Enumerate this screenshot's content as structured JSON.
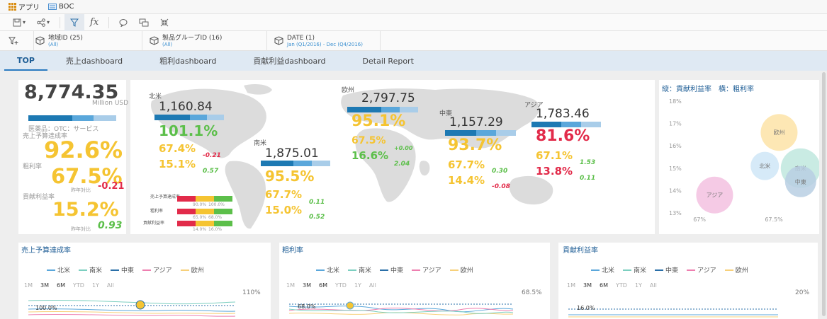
{
  "topbar": {
    "apps_label": "アプリ",
    "doc_label": "BOC"
  },
  "toolbar": {
    "fx_label": "fx"
  },
  "filters": [
    {
      "name": "地域ID (25)",
      "value": "(All)"
    },
    {
      "name": "製品グループID (16)",
      "value": "(All)"
    },
    {
      "name": "DATE (1)",
      "value": "Jan (Q1/2016) - Dec (Q4/2016)"
    }
  ],
  "tabs": [
    "TOP",
    "売上dashboard",
    "粗利dashboard",
    "貢献利益dashboard",
    "Detail Report"
  ],
  "summary": {
    "total": "8,774.35",
    "unit": "Million USD",
    "category": "医薬品：OTC：サービス",
    "sales_label": "売上予算達成率",
    "sales_value": "92.6%",
    "gross_label": "粗利率",
    "gross_value": "67.5%",
    "gross_yoy_label": "昨年対比",
    "gross_yoy": "-0.21",
    "contrib_label": "貢献利益率",
    "contrib_value": "15.2%",
    "contrib_yoy_label": "昨年対比",
    "contrib_yoy": "0.93"
  },
  "regions": {
    "na": {
      "name": "北米",
      "total": "1,160.84",
      "sales": "101.1%",
      "gross": "67.4%",
      "gross_d": "-0.21",
      "contrib": "15.1%",
      "contrib_d": "0.57"
    },
    "sa": {
      "name": "南米",
      "total": "1,875.01",
      "sales": "95.5%",
      "gross": "67.7%",
      "gross_d": "0.11",
      "contrib": "15.0%",
      "contrib_d": "0.52"
    },
    "eu": {
      "name": "欧州",
      "total": "2,797.75",
      "sales": "95.1%",
      "gross": "67.5%",
      "gross_d": "+0.00",
      "contrib": "16.6%",
      "contrib_d": "2.04"
    },
    "me": {
      "name": "中東",
      "total": "1,157.29",
      "sales": "93.7%",
      "gross": "67.7%",
      "gross_d": "0.30",
      "contrib": "14.4%",
      "contrib_d": "-0.08"
    },
    "as": {
      "name": "アジア",
      "total": "1,783.46",
      "sales": "81.6%",
      "gross": "67.1%",
      "gross_d": "1.53",
      "contrib": "13.8%",
      "contrib_d": "0.11"
    }
  },
  "map_legend": {
    "rows": [
      "売上予算達成率",
      "粗利率",
      "貢献利益率"
    ],
    "ticks": [
      "90.0%",
      "100.0%",
      "65.0%",
      "68.0%",
      "14.0%",
      "16.0%"
    ]
  },
  "scatter": {
    "title": "縦：貢献利益率　横：粗利率",
    "y_ticks": [
      "18%",
      "17%",
      "16%",
      "15%",
      "14%",
      "13%"
    ],
    "x_ticks": [
      "67%",
      "67.5%"
    ],
    "bubbles": [
      {
        "label": "欧州",
        "gross": 67.55,
        "contrib": 16.6,
        "color": "#fde3a7"
      },
      {
        "label": "北米",
        "gross": 67.45,
        "contrib": 15.1,
        "color": "#cfe6f7"
      },
      {
        "label": "南米",
        "gross": 67.7,
        "contrib": 15.0,
        "color": "#bfe8de"
      },
      {
        "label": "中東",
        "gross": 67.7,
        "contrib": 14.4,
        "color": "#b9cfe3"
      },
      {
        "label": "アジア",
        "gross": 67.1,
        "contrib": 13.8,
        "color": "#f3c1e0"
      }
    ]
  },
  "legend_items": [
    {
      "label": "北米",
      "color": "#5aa7db"
    },
    {
      "label": "南米",
      "color": "#7ccfc0"
    },
    {
      "label": "中東",
      "color": "#2a6fa8"
    },
    {
      "label": "アジア",
      "color": "#ee7fb0"
    },
    {
      "label": "欧州",
      "color": "#f7d07a"
    }
  ],
  "ranges": [
    "1M",
    "3M",
    "6M",
    "YTD",
    "1Y",
    "All"
  ],
  "panels": [
    {
      "title": "売上予算達成率",
      "axis_top": "110%",
      "ref": "100.0%"
    },
    {
      "title": "粗利率",
      "axis_top": "68.5%",
      "ref": "68.0%"
    },
    {
      "title": "貢献利益率",
      "axis_top": "20%",
      "ref": "16.0%"
    }
  ]
}
